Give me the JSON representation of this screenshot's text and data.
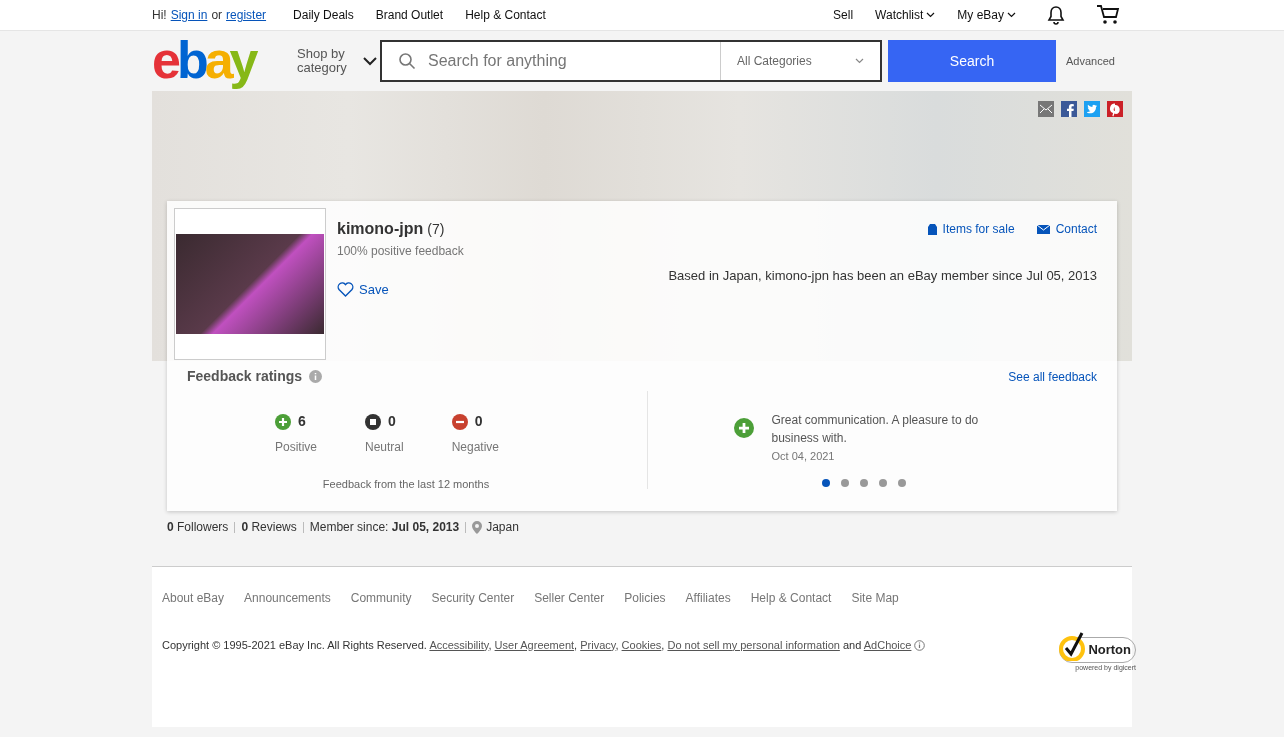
{
  "top_bar": {
    "greeting": "Hi!",
    "sign_in": "Sign in",
    "or": "or",
    "register": "register",
    "links": [
      "Daily Deals",
      "Brand Outlet",
      "Help & Contact"
    ],
    "right_links": [
      {
        "label": "Sell",
        "dropdown": false
      },
      {
        "label": "Watchlist",
        "dropdown": true
      },
      {
        "label": "My eBay",
        "dropdown": true
      }
    ]
  },
  "header": {
    "logo": [
      "e",
      "b",
      "a",
      "y"
    ],
    "shop_by": "Shop by category",
    "search_placeholder": "Search for anything",
    "category": "All Categories",
    "search_button": "Search",
    "advanced": "Advanced"
  },
  "seller": {
    "name": "kimono-jpn",
    "count": "(7)",
    "positive": "100% positive feedback",
    "save": "Save",
    "items_for_sale": "Items for sale",
    "contact": "Contact",
    "about": "Based in Japan, kimono-jpn has been an eBay member since Jul 05, 2013"
  },
  "feedback": {
    "title": "Feedback ratings",
    "see_all": "See all feedback",
    "ratings": [
      {
        "kind": "positive",
        "count": "6",
        "label": "Positive"
      },
      {
        "kind": "neutral",
        "count": "0",
        "label": "Neutral"
      },
      {
        "kind": "negative",
        "count": "0",
        "label": "Negative"
      }
    ],
    "period": "Feedback from the last 12 months",
    "comment": {
      "kind": "positive",
      "text": "Great communication. A pleasure to do business with.",
      "date": "Oct 04, 2021"
    },
    "dots": [
      {
        "selected": true
      },
      {
        "selected": false
      },
      {
        "selected": false
      },
      {
        "selected": false
      },
      {
        "selected": false
      }
    ]
  },
  "stats": [
    "**0** Followers",
    "**0** Reviews",
    "Member since: **Jul 05, 2013**"
  ],
  "location": "Japan",
  "footer": {
    "links": [
      "About eBay",
      "Announcements",
      "Community",
      "Security Center",
      "Seller Center",
      "Policies",
      "Affiliates",
      "Help & Contact",
      "Site Map"
    ],
    "copyright": [
      {
        "kind": "text",
        "text": "Copyright © 1995-2021 eBay Inc. All Rights Reserved. "
      },
      {
        "kind": "link",
        "text": "Accessibility"
      },
      {
        "kind": "text",
        "text": ", "
      },
      {
        "kind": "link",
        "text": "User Agreement"
      },
      {
        "kind": "text",
        "text": ", "
      },
      {
        "kind": "link",
        "text": "Privacy"
      },
      {
        "kind": "text",
        "text": ", "
      },
      {
        "kind": "link",
        "text": "Cookies"
      },
      {
        "kind": "text",
        "text": ", "
      },
      {
        "kind": "link",
        "text": "Do not sell my personal information"
      },
      {
        "kind": "text",
        "text": " and "
      },
      {
        "kind": "link",
        "text": "AdChoice"
      }
    ],
    "norton": "Norton",
    "norton_sub": "powered by digicert"
  }
}
